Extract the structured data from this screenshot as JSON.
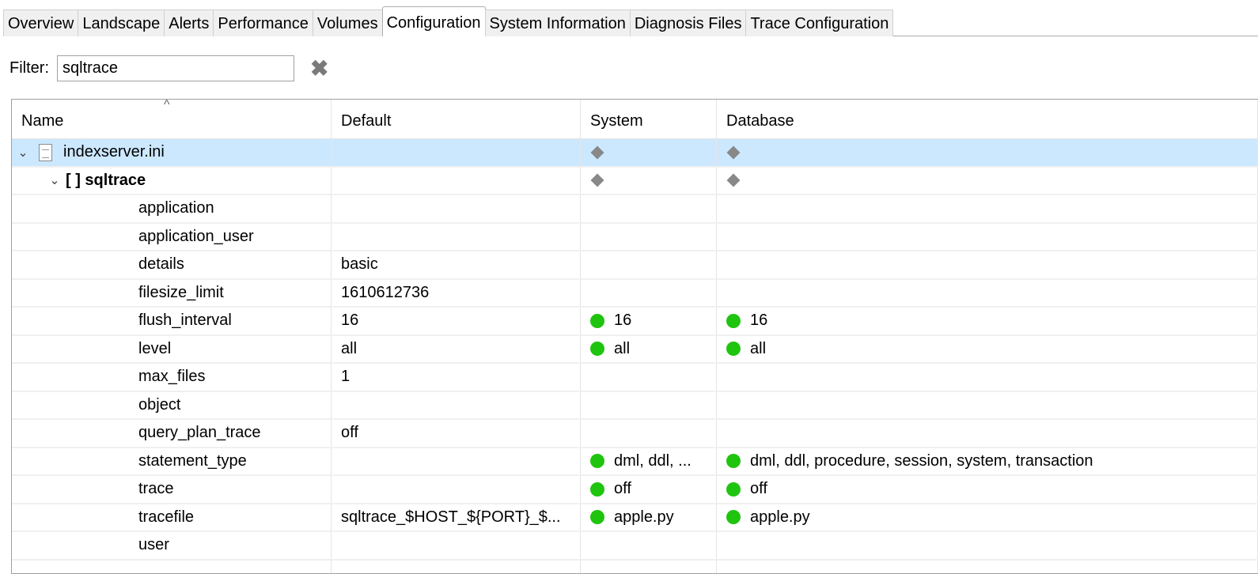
{
  "tabs": [
    "Overview",
    "Landscape",
    "Alerts",
    "Performance",
    "Volumes",
    "Configuration",
    "System Information",
    "Diagnosis Files",
    "Trace Configuration"
  ],
  "active_tab": "Configuration",
  "filter": {
    "label": "Filter:",
    "value": "sqltrace"
  },
  "columns": [
    "Name",
    "Default",
    "System",
    "Database"
  ],
  "file": {
    "name": "indexserver.ini"
  },
  "section": {
    "name": "[ ] sqltrace"
  },
  "params": [
    {
      "name": "application",
      "default": "",
      "system": "",
      "database": ""
    },
    {
      "name": "application_user",
      "default": "",
      "system": "",
      "database": ""
    },
    {
      "name": "details",
      "default": "basic",
      "system": "",
      "database": ""
    },
    {
      "name": "filesize_limit",
      "default": "1610612736",
      "system": "",
      "database": ""
    },
    {
      "name": "flush_interval",
      "default": "16",
      "system": "16",
      "database": "16"
    },
    {
      "name": "level",
      "default": "all",
      "system": "all",
      "database": "all"
    },
    {
      "name": "max_files",
      "default": "1",
      "system": "",
      "database": ""
    },
    {
      "name": "object",
      "default": "",
      "system": "",
      "database": ""
    },
    {
      "name": "query_plan_trace",
      "default": "off",
      "system": "",
      "database": ""
    },
    {
      "name": "statement_type",
      "default": "",
      "system": "dml, ddl, ...",
      "database": "dml, ddl, procedure, session, system, transaction"
    },
    {
      "name": "trace",
      "default": "",
      "system": "off",
      "database": "off"
    },
    {
      "name": "tracefile",
      "default": "sqltrace_$HOST_${PORT}_$...",
      "system": "apple.py",
      "database": "apple.py"
    },
    {
      "name": "user",
      "default": "",
      "system": "",
      "database": ""
    }
  ]
}
